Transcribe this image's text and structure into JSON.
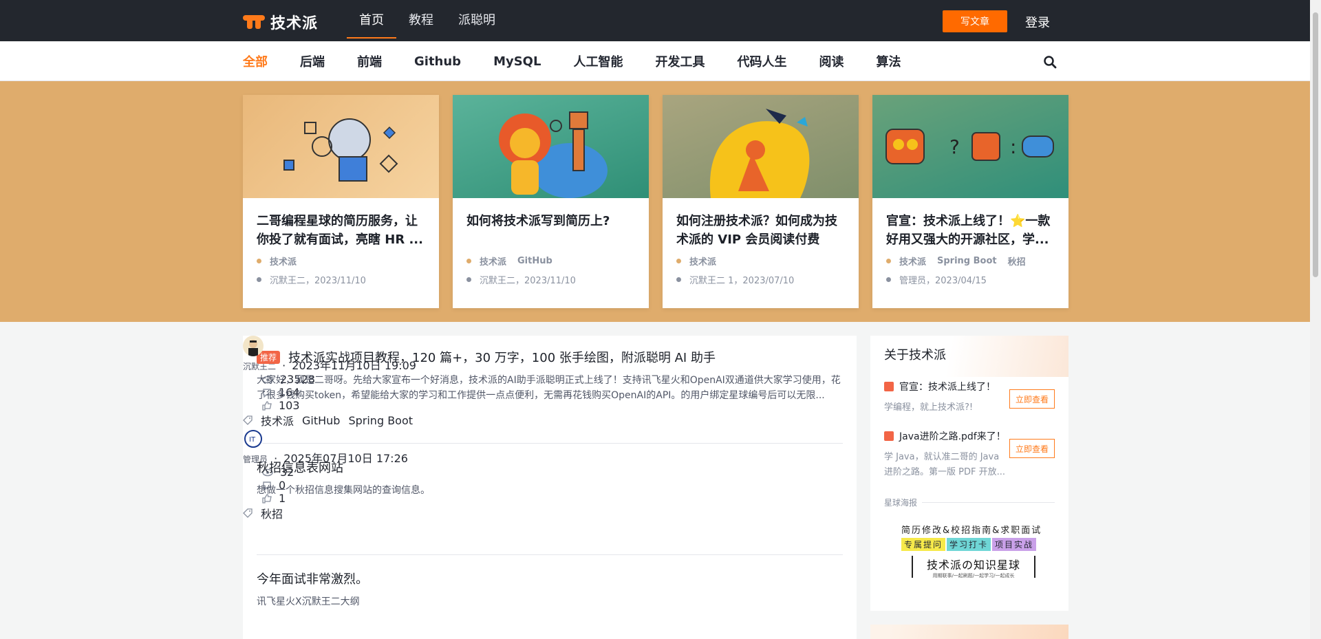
{
  "header": {
    "logo_text": "技术派",
    "nav": [
      {
        "label": "首页",
        "active": true
      },
      {
        "label": "教程",
        "active": false
      },
      {
        "label": "派聪明",
        "active": false
      }
    ],
    "write_button": "写文章",
    "login": "登录"
  },
  "categories": [
    {
      "label": "全部",
      "active": true
    },
    {
      "label": "后端"
    },
    {
      "label": "前端"
    },
    {
      "label": "Github"
    },
    {
      "label": "MySQL"
    },
    {
      "label": "人工智能"
    },
    {
      "label": "开发工具"
    },
    {
      "label": "代码人生"
    },
    {
      "label": "阅读"
    },
    {
      "label": "算法"
    }
  ],
  "banner_cards": [
    {
      "title": "二哥编程星球的简历服务，让你投了就有面试，亮瞎 HR ...",
      "tags": [
        "技术派"
      ],
      "meta": "沉默王二，2023/11/10"
    },
    {
      "title": "如何将技术派写到简历上?",
      "tags": [
        "技术派",
        "GitHub"
      ],
      "meta": "沉默王二，2023/11/10"
    },
    {
      "title": "如何注册技术派？如何成为技术派的 VIP 会员阅读付费专...",
      "tags": [
        "技术派"
      ],
      "meta": "沉默王二 1，2023/07/10"
    },
    {
      "title": "官宣：技术派上线了！⭐一款好用又强大的开源社区，学...",
      "tags": [
        "技术派",
        "Spring Boot",
        "秋招"
      ],
      "meta": "管理员，2023/04/15"
    }
  ],
  "articles": [
    {
      "badge": "推荐",
      "title": "技术派实战项目教程，120 篇+，30 万字，100 张手绘图，附派聪明 AI 助手",
      "summary": "大家好，我是二哥呀。先给大家宣布一个好消息，技术派的AI助手派聪明正式上线了！支持讯飞星火和OpenAI双通道供大家学习使用，花了很多钱购买token，希望能给大家的学习和工作提供一点点便利，无需再花钱购买OpenAI的API。的用户绑定星球编号后可以无限...",
      "author": "沉默王二",
      "time": "2023年11月10日 19:09",
      "views": "23528",
      "comments": "164",
      "likes": "103",
      "tags": [
        "技术派",
        "GitHub",
        "Spring Boot"
      ]
    },
    {
      "title": "秋招信息表网站",
      "summary": "想做一个秋招信息搜集网站的查询信息。",
      "author": "管理员",
      "time": "2025年07月10日 17:26",
      "views": "32",
      "comments": "0",
      "likes": "1",
      "tags": [
        "秋招"
      ]
    },
    {
      "title": "今年面试非常激烈。",
      "summary": "讯飞星火X沉默王二大纲"
    }
  ],
  "sidebar": {
    "title": "关于技术派",
    "items": [
      {
        "title": "官宣：技术派上线了！",
        "desc": "学编程，就上技术派?!",
        "button": "立即查看"
      },
      {
        "title": "Java进阶之路.pdf来了！",
        "desc": "学 Java，就认准二哥的 Java 进阶之路。第一版 PDF 开放...",
        "button": "立即查看"
      }
    ],
    "poster_label": "星球海报",
    "poster": {
      "line1": "简历修改&校招指南&求职面试",
      "chips": [
        "专属提问",
        "学习打卡",
        "项目实战"
      ],
      "headline": "技术派の知识星球",
      "sub": "用期联事/一起刷题/一起学习/一起成长"
    }
  },
  "colors": {
    "accent": "#ff7a1a",
    "topbar": "#23272e",
    "banner": "#dfac6c",
    "badge": "#f26546"
  }
}
